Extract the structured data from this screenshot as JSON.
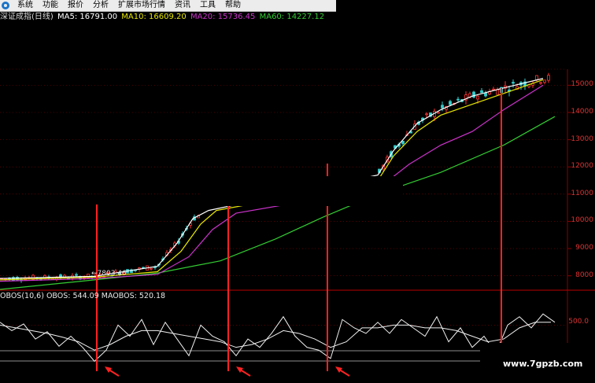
{
  "menubar": {
    "items": [
      {
        "label": "系统",
        "name": "menu-system"
      },
      {
        "label": "功能",
        "name": "menu-function"
      },
      {
        "label": "报价",
        "name": "menu-quote"
      },
      {
        "label": "分析",
        "name": "menu-analysis"
      },
      {
        "label": "扩展市场行情",
        "name": "menu-extended-market"
      },
      {
        "label": "资讯",
        "name": "menu-news"
      },
      {
        "label": "工具",
        "name": "menu-tools"
      },
      {
        "label": "帮助",
        "name": "menu-help"
      }
    ]
  },
  "indicator_line": {
    "title": "深证成指(日线)",
    "ma5": "MA5: 16791.00",
    "ma10": "MA10: 16609.20",
    "ma20": "MA20: 15736.45",
    "ma60": "MA60: 14227.12"
  },
  "obos_line": {
    "label": "OBOS(10,6)",
    "obos": "OBOS: 544.09",
    "maobos": "MAOBOS: 520.18"
  },
  "low_label": "←7803.46",
  "obos_tick": "500.0",
  "watermark": "www.7gpzb.com",
  "colors": {
    "ma5": "#ffffff",
    "ma10": "#e6e600",
    "ma20": "#cc33cc",
    "ma60": "#33cc33",
    "candle_up": "#ff3333",
    "candle_down": "#33cccc",
    "marker": "#ff2222",
    "grid": "#8b0000",
    "axis_text": "#dd3333"
  },
  "chart_data": {
    "type": "line",
    "title": "深证成指(日线)",
    "y_axis_ticks": [
      "15000",
      "14000",
      "13000",
      "12000",
      "11000",
      "10000",
      "9000",
      "8000"
    ],
    "y_range": [
      7500,
      15300
    ],
    "x_range": [
      0,
      720
    ],
    "series": [
      {
        "name": "MA60",
        "x": [
          0,
          120,
          200,
          280,
          350,
          410,
          480,
          560,
          640,
          705
        ],
        "values": [
          7500,
          7850,
          8100,
          8550,
          9350,
          10150,
          11000,
          11800,
          12800,
          13850
        ]
      },
      {
        "name": "MA20",
        "x": [
          0,
          120,
          200,
          240,
          270,
          300,
          480,
          520,
          560,
          600,
          640,
          690
        ],
        "values": [
          7800,
          7900,
          8050,
          8700,
          9700,
          10300,
          11200,
          12100,
          12800,
          13300,
          14100,
          15000
        ]
      },
      {
        "name": "MA10",
        "x": [
          0,
          120,
          200,
          230,
          255,
          275,
          480,
          500,
          530,
          560,
          600,
          640,
          690
        ],
        "values": [
          7850,
          7950,
          8150,
          8900,
          9900,
          10400,
          11500,
          12400,
          13300,
          13900,
          14300,
          14700,
          15200
        ]
      },
      {
        "name": "MA5",
        "x": [
          0,
          120,
          200,
          225,
          245,
          265,
          480,
          500,
          530,
          560,
          600,
          640,
          690
        ],
        "values": [
          7900,
          7980,
          8350,
          9200,
          10100,
          10400,
          11700,
          12600,
          13600,
          14100,
          14600,
          14900,
          15250
        ]
      }
    ],
    "markers_x": [
      122,
      289,
      415,
      636
    ],
    "lowest_point": {
      "x": 120,
      "value": 7803.46
    },
    "obos": {
      "range": [
        -300,
        900
      ],
      "tick": 500.0,
      "series": [
        {
          "name": "OBOS",
          "x": [
            0,
            15,
            30,
            45,
            60,
            75,
            90,
            105,
            120,
            135,
            150,
            165,
            180,
            195,
            210,
            225,
            240,
            255,
            270,
            285,
            300,
            315,
            330,
            345,
            360,
            375,
            390,
            405,
            420,
            435,
            450,
            465,
            480,
            495,
            510,
            525,
            540,
            555,
            570,
            585,
            600,
            615,
            630,
            645,
            660,
            675,
            690,
            705
          ],
          "values": [
            550,
            400,
            520,
            250,
            380,
            120,
            300,
            100,
            -150,
            50,
            500,
            300,
            600,
            150,
            550,
            250,
            -50,
            500,
            300,
            200,
            -50,
            250,
            100,
            350,
            650,
            300,
            100,
            50,
            -100,
            600,
            450,
            350,
            550,
            350,
            600,
            450,
            300,
            650,
            200,
            450,
            100,
            300,
            0,
            500,
            650,
            450,
            700,
            550
          ]
        },
        {
          "name": "MAOBOS",
          "x": [
            0,
            20,
            40,
            60,
            80,
            100,
            120,
            140,
            160,
            180,
            200,
            220,
            240,
            260,
            280,
            300,
            320,
            340,
            360,
            380,
            400,
            420,
            440,
            460,
            480,
            500,
            520,
            540,
            560,
            580,
            600,
            620,
            640,
            660,
            680,
            700
          ],
          "values": [
            500,
            450,
            400,
            350,
            280,
            200,
            50,
            150,
            300,
            400,
            400,
            350,
            300,
            250,
            200,
            100,
            150,
            250,
            400,
            350,
            250,
            100,
            200,
            450,
            450,
            500,
            500,
            450,
            450,
            400,
            300,
            200,
            250,
            450,
            550,
            550
          ]
        }
      ]
    }
  }
}
